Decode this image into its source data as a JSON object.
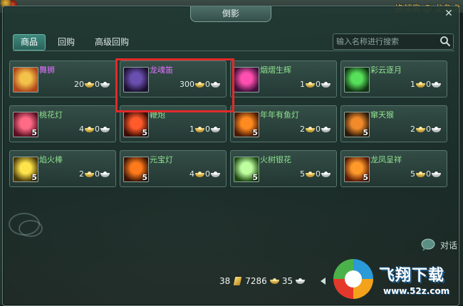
{
  "header": {
    "server_text": "换领奥 @ 龙争虎",
    "window_title": "倒影"
  },
  "tabs": [
    {
      "label": "商品",
      "active": true
    },
    {
      "label": "回购",
      "active": false
    },
    {
      "label": "高级回购",
      "active": false
    }
  ],
  "search": {
    "placeholder": "输入名称进行搜索"
  },
  "items": [
    {
      "name": "舞狮",
      "count": "",
      "price": "20",
      "gold": "0",
      "silver": "",
      "name_color": "#e070ff",
      "icon": "lion-dance-icon",
      "c1": "#f3c24a",
      "c2": "#b0471a"
    },
    {
      "name": "龙魂笛",
      "count": "",
      "price": "300",
      "gold": "0",
      "silver": "",
      "name_color": "#e070ff",
      "icon": "dragon-flute-icon",
      "c1": "#6a4fb0",
      "c2": "#1c1030"
    },
    {
      "name": "烟熠生辉",
      "count": "",
      "price": "1",
      "gold": "0",
      "silver": "",
      "name_color": "#8fe28f",
      "icon": "firework-pink-icon",
      "c1": "#ff4fb0",
      "c2": "#40103a"
    },
    {
      "name": "彩云逐月",
      "count": "",
      "price": "1",
      "gold": "0",
      "silver": "",
      "name_color": "#8fe28f",
      "icon": "firework-green-icon",
      "c1": "#57e05a",
      "c2": "#0f3412"
    },
    {
      "name": "桃花灯",
      "count": "5",
      "price": "4",
      "gold": "0",
      "silver": "",
      "name_color": "#8fe28f",
      "icon": "peach-lantern-icon",
      "c1": "#ff6a86",
      "c2": "#5a1022"
    },
    {
      "name": "鞭炮",
      "count": "5",
      "price": "1",
      "gold": "0",
      "silver": "",
      "name_color": "#8fe28f",
      "icon": "firecracker-icon",
      "c1": "#ff5a2a",
      "c2": "#3a0c06"
    },
    {
      "name": "年年有鱼灯",
      "count": "5",
      "price": "2",
      "gold": "0",
      "silver": "",
      "name_color": "#8fe28f",
      "icon": "fish-lantern-icon",
      "c1": "#ff8a20",
      "c2": "#4a1a06"
    },
    {
      "name": "窜天猴",
      "count": "5",
      "price": "2",
      "gold": "0",
      "silver": "",
      "name_color": "#8fe28f",
      "icon": "rocket-icon",
      "c1": "#f08a2a",
      "c2": "#2a1a0a"
    },
    {
      "name": "焰火棒",
      "count": "5",
      "price": "2",
      "gold": "0",
      "silver": "",
      "name_color": "#8fe28f",
      "icon": "sparkler-icon",
      "c1": "#ffe34a",
      "c2": "#4a3a0a"
    },
    {
      "name": "元宝灯",
      "count": "5",
      "price": "4",
      "gold": "0",
      "silver": "",
      "name_color": "#8fe28f",
      "icon": "ingot-lantern-icon",
      "c1": "#ff7a1a",
      "c2": "#3a1406"
    },
    {
      "name": "火树银花",
      "count": "5",
      "price": "5",
      "gold": "0",
      "silver": "",
      "name_color": "#8fe28f",
      "icon": "silver-tree-lantern-icon",
      "c1": "#bfffa0",
      "c2": "#1e4a12"
    },
    {
      "name": "龙凤呈祥",
      "count": "5",
      "price": "5",
      "gold": "0",
      "silver": "",
      "name_color": "#8fe28f",
      "icon": "dragon-phoenix-lantern-icon",
      "c1": "#ff9a2a",
      "c2": "#5a1a06"
    }
  ],
  "chat": {
    "label": "对话"
  },
  "currency": {
    "gold_bars": "38",
    "ingots": "7286",
    "silver": "35"
  },
  "watermark": {
    "title": "飞翔下载",
    "url": "www.52z.com"
  }
}
